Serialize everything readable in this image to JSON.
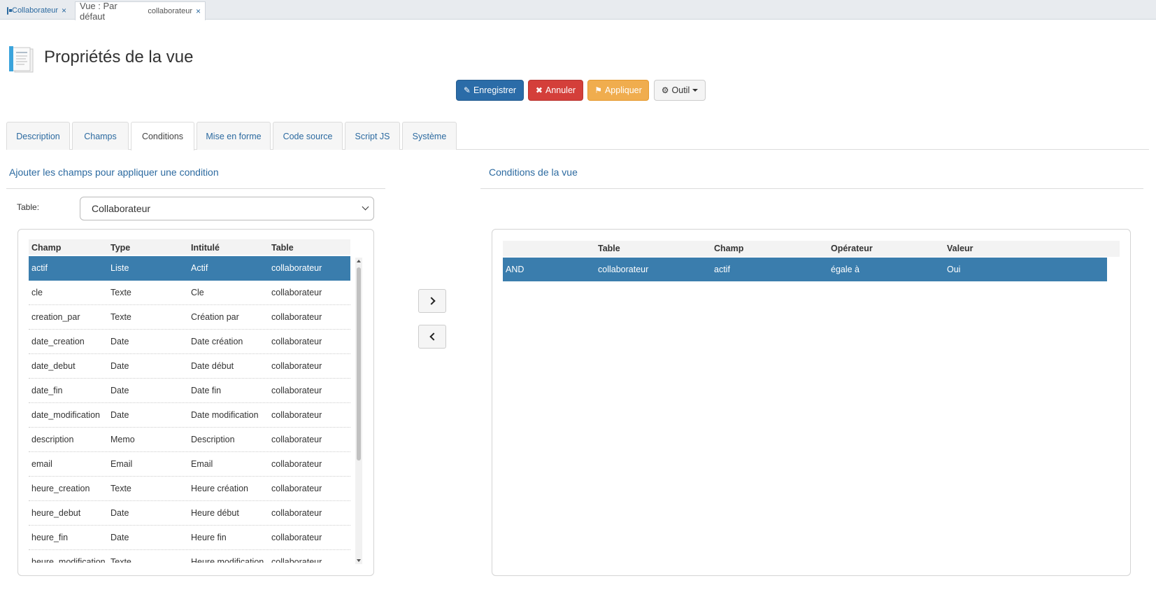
{
  "window_tabs": [
    {
      "label": "Collaborateur",
      "close": "×"
    },
    {
      "label": "Vue : Par défaut",
      "sub": "collaborateur",
      "close": "×"
    }
  ],
  "page": {
    "title": "Propriétés de la vue"
  },
  "toolbar": {
    "save_label": "Enregistrer",
    "cancel_label": "Annuler",
    "apply_label": "Appliquer",
    "tool_label": "Outil"
  },
  "tabs": [
    "Description",
    "Champs",
    "Conditions",
    "Mise en forme",
    "Code source",
    "Script JS",
    "Système"
  ],
  "active_tab": "Conditions",
  "left_section": {
    "title": "Ajouter les champs pour appliquer une condition",
    "table_label": "Table:",
    "table_value": "Collaborateur",
    "columns": [
      "Champ",
      "Type",
      "Intitulé",
      "Table"
    ],
    "rows": [
      [
        "actif",
        "Liste",
        "Actif",
        "collaborateur"
      ],
      [
        "cle",
        "Texte",
        "Cle",
        "collaborateur"
      ],
      [
        "creation_par",
        "Texte",
        "Création par",
        "collaborateur"
      ],
      [
        "date_creation",
        "Date",
        "Date création",
        "collaborateur"
      ],
      [
        "date_debut",
        "Date",
        "Date début",
        "collaborateur"
      ],
      [
        "date_fin",
        "Date",
        "Date fin",
        "collaborateur"
      ],
      [
        "date_modification",
        "Date",
        "Date modification",
        "collaborateur"
      ],
      [
        "description",
        "Memo",
        "Description",
        "collaborateur"
      ],
      [
        "email",
        "Email",
        "Email",
        "collaborateur"
      ],
      [
        "heure_creation",
        "Texte",
        "Heure création",
        "collaborateur"
      ],
      [
        "heure_debut",
        "Date",
        "Heure début",
        "collaborateur"
      ],
      [
        "heure_fin",
        "Date",
        "Heure fin",
        "collaborateur"
      ],
      [
        "heure_modification",
        "Texte",
        "Heure modification",
        "collaborateur"
      ]
    ],
    "selected_row": 0
  },
  "right_section": {
    "title": "Conditions de la vue",
    "columns": [
      "",
      "Table",
      "Champ",
      "Opérateur",
      "Valeur"
    ],
    "rows": [
      [
        "AND",
        "collaborateur",
        "actif",
        "égale à",
        "Oui"
      ]
    ]
  },
  "colors": {
    "primary": "#2b6ca8",
    "danger": "#d43f3a",
    "warning": "#f0ad4e",
    "selection": "#3a7dad",
    "link": "#2c6aa0"
  }
}
